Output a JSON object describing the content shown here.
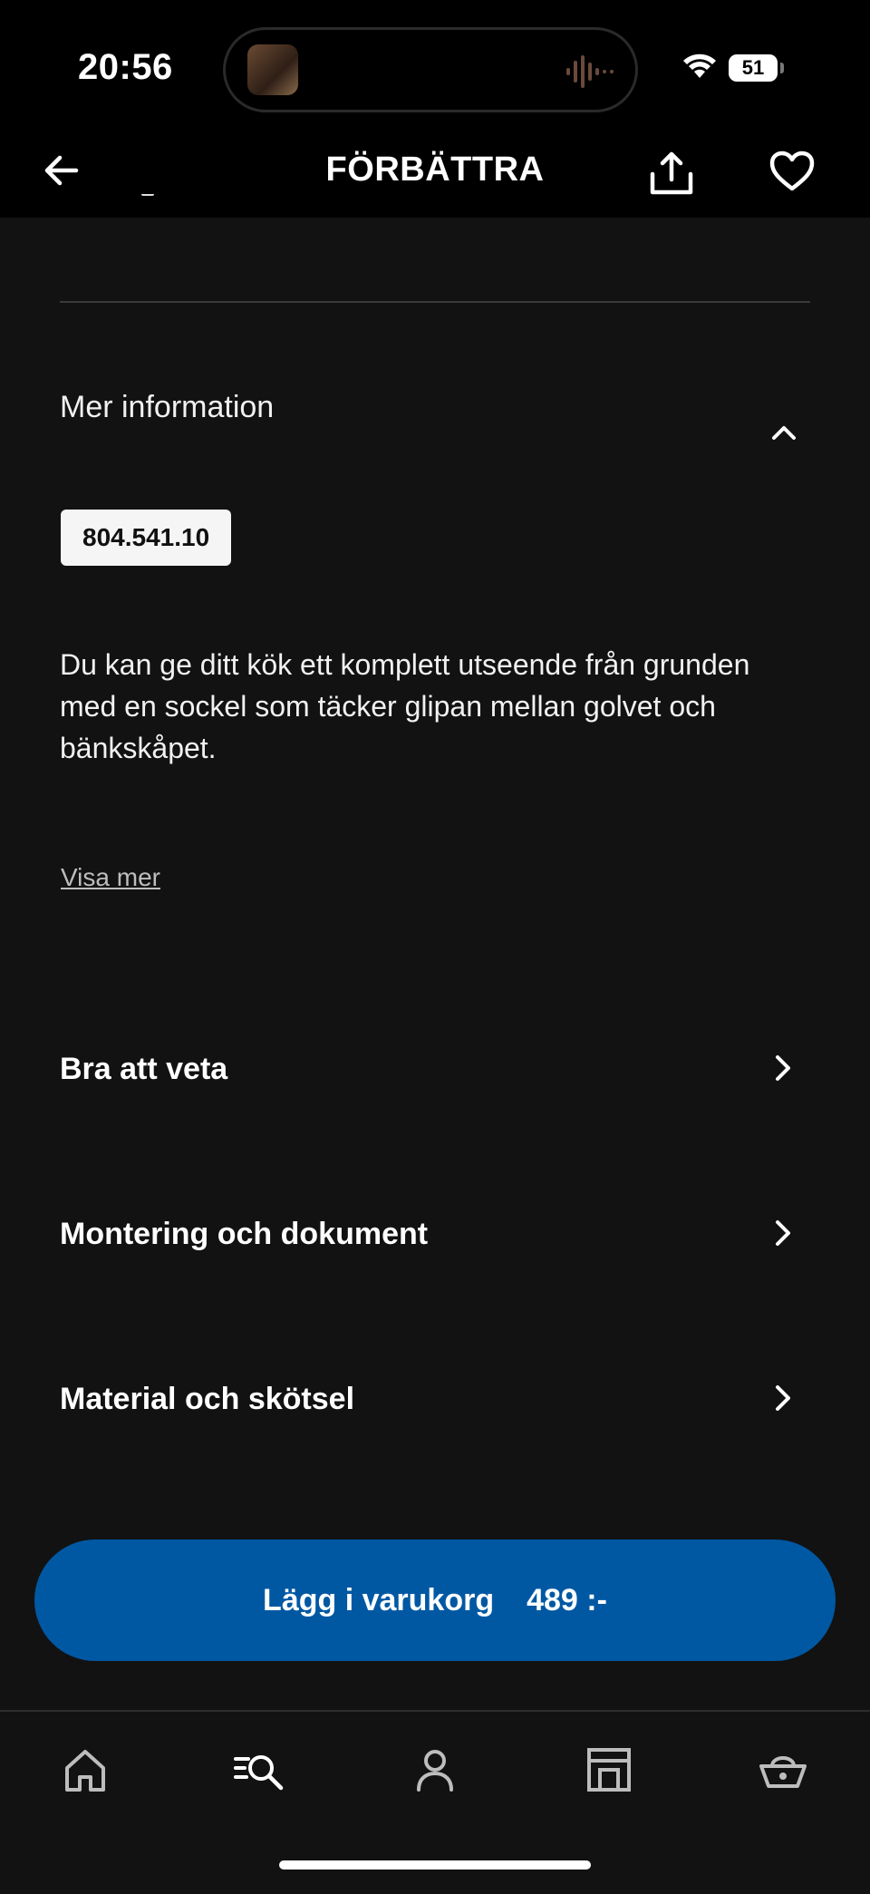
{
  "status_bar": {
    "time": "20:56",
    "battery": "51"
  },
  "nav": {
    "title": "FÖRBÄTTRA",
    "back_icon": "arrow-left-icon",
    "share_icon": "share-icon",
    "favorite_icon": "heart-icon"
  },
  "more_info": {
    "title": "Mer information",
    "article_number": "804.541.10",
    "description": "Du kan ge ditt kök ett komplett utseende från grunden med en sockel som täcker glipan mellan golvet och bänkskåpet.",
    "show_more": "Visa mer"
  },
  "sections": [
    {
      "label": "Bra att veta"
    },
    {
      "label": "Montering och dokument"
    },
    {
      "label": "Material och skötsel"
    }
  ],
  "cta": {
    "label": "Lägg i varukorg",
    "price": "489 :-",
    "color": "#0058a3"
  },
  "tabbar": {
    "items": [
      {
        "icon": "home-icon"
      },
      {
        "icon": "search-icon"
      },
      {
        "icon": "profile-icon"
      },
      {
        "icon": "store-icon"
      },
      {
        "icon": "cart-icon"
      }
    ]
  }
}
